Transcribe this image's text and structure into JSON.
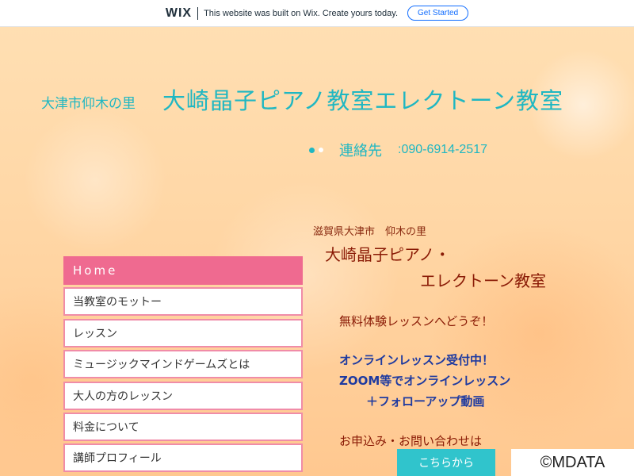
{
  "wix_bar": {
    "logo": "WIX",
    "message": "This website was built on Wix. Create yours today.",
    "button": "Get Started"
  },
  "header": {
    "region": "大津市仰木の里",
    "title": "大崎晶子ピアノ教室エレクトーン教室",
    "contact_label": "連絡先",
    "phone": ":090-6914-2517"
  },
  "nav": {
    "items": [
      "Home",
      "当教室のモットー",
      "レッスン",
      "ミュージックマインドゲームズとは",
      "大人の方のレッスン",
      "料金について",
      "講師プロフィール"
    ]
  },
  "intro": {
    "location": "滋賀県大津市　仰木の里",
    "name_line1": "大崎晶子ピアノ・",
    "name_line2": "エレクトーン教室",
    "trial": "無料体験レッスンへどうぞ！",
    "online_line1": "オンラインレッスン受付中！",
    "online_line2": "ZOOM等でオンラインレッスン",
    "online_line3": "＋フォローアップ動画",
    "apply": "お申込み・お問い合わせは",
    "cta": "こちらから"
  },
  "watermark": "©MDATA",
  "colors": {
    "accent_teal": "#1fb7c2",
    "nav_pink": "#ef6a90",
    "text_brown": "#8a1a05",
    "text_blue": "#1e3aa0"
  }
}
